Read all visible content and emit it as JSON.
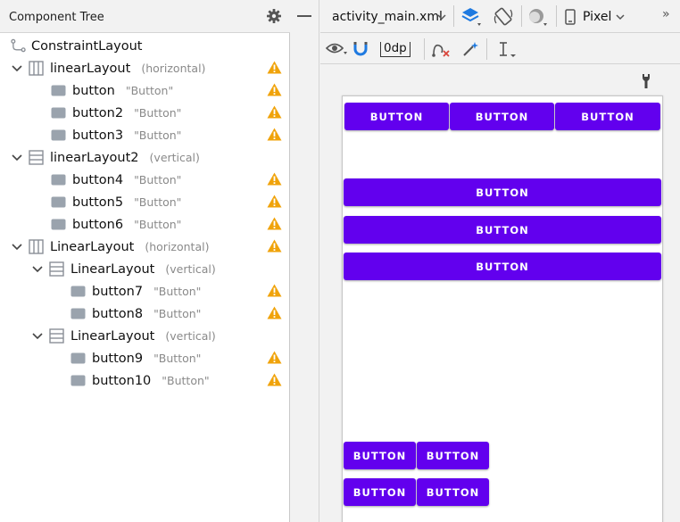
{
  "tree": {
    "title": "Component Tree",
    "rows": [
      {
        "name": "ConstraintLayout",
        "sub": ""
      },
      {
        "name": "linearLayout",
        "sub": "(horizontal)"
      },
      {
        "name": "button",
        "sub": "\"Button\""
      },
      {
        "name": "button2",
        "sub": "\"Button\""
      },
      {
        "name": "button3",
        "sub": "\"Button\""
      },
      {
        "name": "linearLayout2",
        "sub": "(vertical)"
      },
      {
        "name": "button4",
        "sub": "\"Button\""
      },
      {
        "name": "button5",
        "sub": "\"Button\""
      },
      {
        "name": "button6",
        "sub": "\"Button\""
      },
      {
        "name": "LinearLayout",
        "sub": "(horizontal)"
      },
      {
        "name": "LinearLayout",
        "sub": "(vertical)"
      },
      {
        "name": "button7",
        "sub": "\"Button\""
      },
      {
        "name": "button8",
        "sub": "\"Button\""
      },
      {
        "name": "LinearLayout",
        "sub": "(vertical)"
      },
      {
        "name": "button9",
        "sub": "\"Button\""
      },
      {
        "name": "button10",
        "sub": "\"Button\""
      }
    ]
  },
  "toolbar": {
    "file": "activity_main.xml",
    "device": "Pixel",
    "margin": "0dp",
    "overflow": "»"
  },
  "design": {
    "button_label": "BUTTON"
  },
  "colors": {
    "accent": "#6200ee",
    "warning": "#f0a30a",
    "layers": "#1f7ae0"
  }
}
